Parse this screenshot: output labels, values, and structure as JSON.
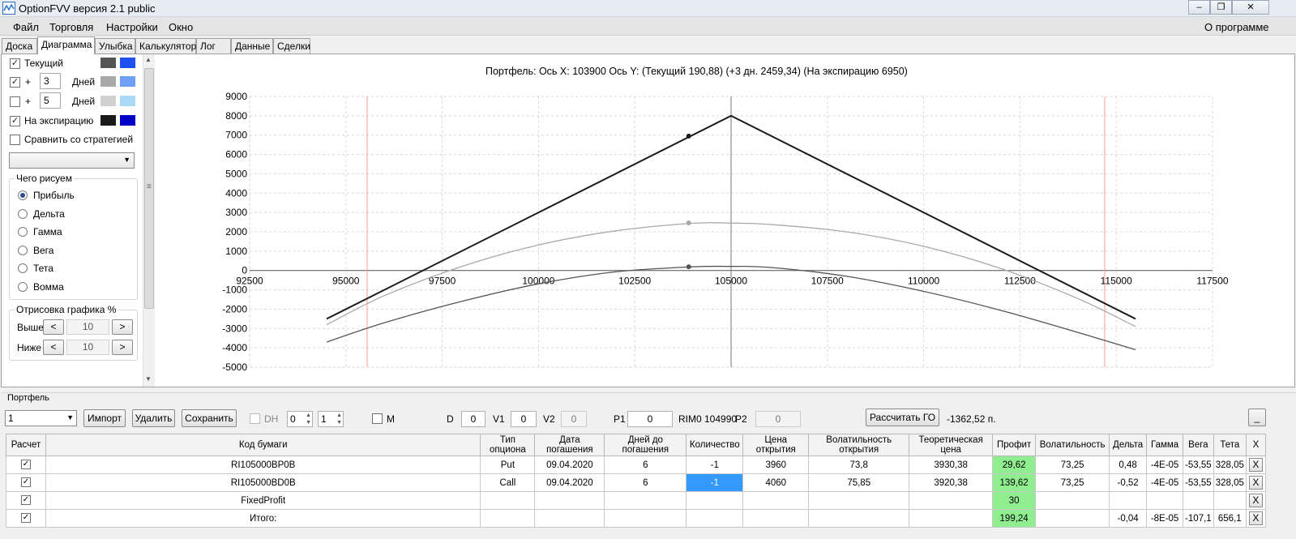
{
  "window": {
    "title": "OptionFVV версия 2.1 public"
  },
  "menu": {
    "items": [
      "Файл",
      "Торговля",
      "Настройки",
      "Окно"
    ],
    "about": "О программе"
  },
  "tabs": [
    "Доска",
    "Диаграмма",
    "Улыбка",
    "Калькулятор",
    "Лог",
    "Данные",
    "Сделки"
  ],
  "left_panel": {
    "current_label": "Текущий",
    "plus_sign": "+",
    "days_label": "Дней",
    "plus_days_1": "3",
    "plus_days_2": "5",
    "expiration_label": "На экспирацию",
    "compare_label": "Сравнить со стратегией",
    "what_group": "Чего рисуем",
    "options": [
      "Прибыль",
      "Дельта",
      "Гамма",
      "Вега",
      "Тета",
      "Вомма"
    ],
    "draw_group": "Отрисовка графика %",
    "above_label": "Выше",
    "below_label": "Ниже",
    "above_value": "10",
    "below_value": "10",
    "dec_symbol": "<",
    "inc_symbol": ">",
    "colors": {
      "current": [
        "#555555",
        "#1e50f0"
      ],
      "plus1": [
        "#a9a9a9",
        "#6ea0f5"
      ],
      "plus2": [
        "#d0d0d0",
        "#aad8f7"
      ],
      "expiration": [
        "#1a1a1a",
        "#0000c8"
      ]
    }
  },
  "chart_header": {
    "portfolio": "Портфель:",
    "xaxis": "Ось X:",
    "x_value": "103900",
    "yaxis": "Ось Y:",
    "current": "(Текущий 190,88)",
    "plus3": "(+3 дн. 2459,34)",
    "expiration": "(На экспирацию 6950)"
  },
  "chart_data": {
    "type": "line",
    "xlim": [
      92500,
      117500
    ],
    "ylim": [
      -5000,
      9000
    ],
    "x_ticks": [
      "92500",
      "95000",
      "97500",
      "100000",
      "102500",
      "105000",
      "107500",
      "110000",
      "112500",
      "115000",
      "117500"
    ],
    "y_ticks": [
      "9000",
      "8000",
      "7000",
      "6000",
      "5000",
      "4000",
      "3000",
      "2000",
      "1000",
      "0",
      "-1000",
      "-2000",
      "-3000",
      "-4000",
      "-5000"
    ],
    "grid": true,
    "series": [
      {
        "color": "#1a1a1a",
        "x": [
          94500,
          105000,
          115500
        ],
        "y": [
          -2500,
          8000,
          -2500
        ]
      },
      {
        "color": "#a9a9a9",
        "x": [
          94500,
          96000,
          98000,
          100000,
          102000,
          104000,
          105000,
          106000,
          108000,
          110000,
          112000,
          114000,
          115500
        ],
        "y": [
          -2800,
          -1300,
          200,
          1320,
          2050,
          2440,
          2450,
          2380,
          2000,
          1250,
          100,
          -1450,
          -2900
        ]
      },
      {
        "color": "#555555",
        "x": [
          94500,
          96000,
          98000,
          100000,
          102000,
          104000,
          105000,
          106000,
          108000,
          110000,
          112000,
          114000,
          115500
        ],
        "y": [
          -3700,
          -2700,
          -1600,
          -690,
          -70,
          190,
          210,
          160,
          -300,
          -1080,
          -2060,
          -3200,
          -4100
        ]
      }
    ],
    "markers": [
      {
        "x": 103900,
        "y": 6950,
        "color": "#1a1a1a"
      },
      {
        "x": 103900,
        "y": 2459.34,
        "color": "#a9a9a9"
      },
      {
        "x": 103900,
        "y": 190.88,
        "color": "#555555"
      }
    ],
    "vlines": [
      {
        "x": 105000,
        "color": "#777777"
      },
      {
        "x": 95550,
        "color": "#ff9999"
      },
      {
        "x": 114700,
        "color": "#ff9999"
      }
    ]
  },
  "portfolio": {
    "label": "Портфель",
    "selected": "1",
    "import": "Импорт",
    "delete": "Удалить",
    "save": "Сохранить",
    "dh_label": "DH",
    "dh1": "0",
    "dh2": "1",
    "m_label": "M",
    "d_label": "D",
    "d_value": "0",
    "v1_label": "V1",
    "v1_value": "0",
    "v2_label": "V2",
    "v2_value": "0",
    "p1_label": "P1",
    "p1_value": "0",
    "rim_label": "RIM0 104990",
    "p2_label": "P2",
    "p2_value": "0",
    "calc_go": "Рассчитать ГО",
    "go_value": "-1362,52 п.",
    "minimize": "_"
  },
  "table": {
    "headers": [
      "Расчет",
      "Код бумаги",
      "Тип опциона",
      "Дата погашения",
      "Дней до погашения",
      "Количество",
      "Цена открытия",
      "Волатильность открытия",
      "Теоретическая цена",
      "Профит",
      "Волатильность",
      "Дельта",
      "Гамма",
      "Вега",
      "Тета",
      "X"
    ],
    "rows": [
      [
        "✓",
        "RI105000BP0B",
        "Put",
        "09.04.2020",
        "6",
        "-1",
        "3960",
        "73,8",
        "3930,38",
        "29,62",
        "73,25",
        "0,48",
        "-4E-05",
        "-53,55",
        "328,05",
        "X"
      ],
      [
        "✓",
        "RI105000BD0B",
        "Call",
        "09.04.2020",
        "6",
        "-1",
        "4060",
        "75,85",
        "3920,38",
        "139,62",
        "73,25",
        "-0,52",
        "-4E-05",
        "-53,55",
        "328,05",
        "X"
      ],
      [
        "✓",
        "FixedProfit",
        "",
        "",
        "",
        "",
        "",
        "",
        "",
        "30",
        "",
        "",
        "",
        "",
        "",
        "X"
      ],
      [
        "✓",
        "Итого:",
        "",
        "",
        "",
        "",
        "",
        "",
        "",
        "199,24",
        "",
        "-0,04",
        "-8E-05",
        "-107,1",
        "656,1",
        "X"
      ]
    ]
  }
}
